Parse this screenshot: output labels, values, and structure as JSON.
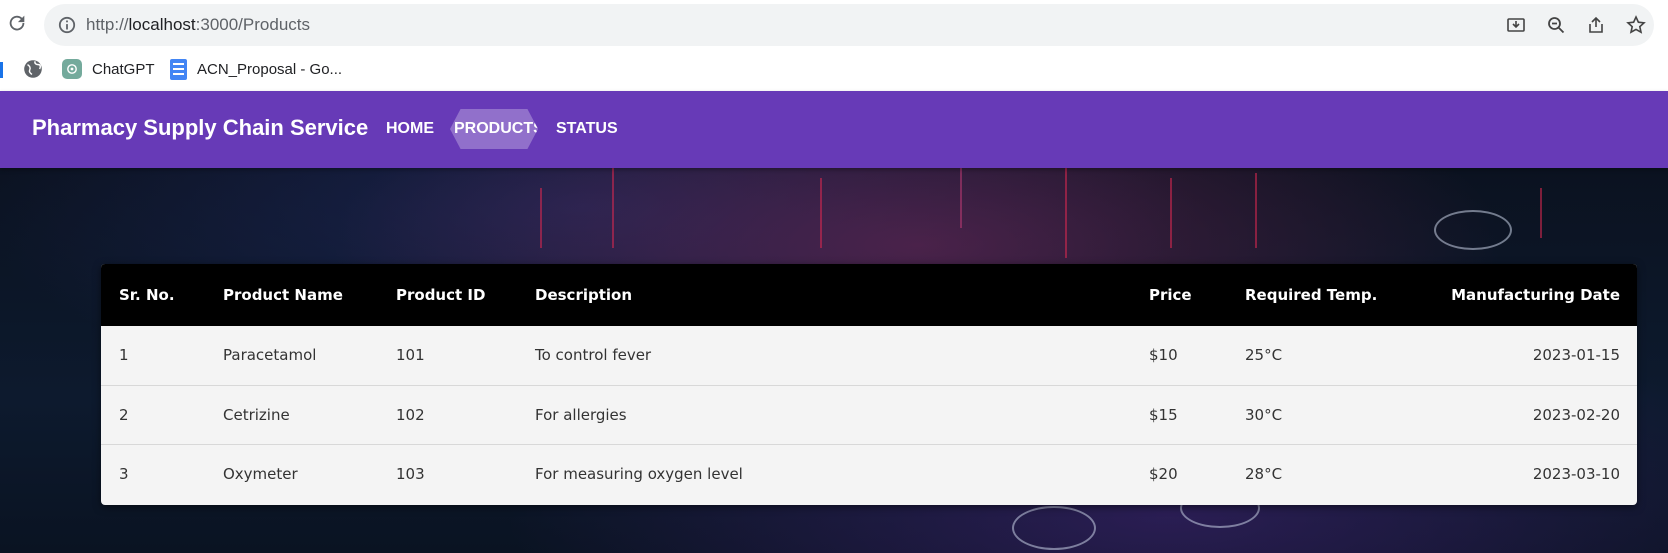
{
  "browser": {
    "url_prefix": "http://",
    "url_host": "localhost",
    "url_rest": ":3000/Products",
    "bookmarks": [
      {
        "label": "ChatGPT",
        "icon": "chatgpt-icon"
      },
      {
        "label": "ACN_Proposal - Go...",
        "icon": "google-docs-icon"
      }
    ]
  },
  "app": {
    "brand": "Pharmacy Supply Chain Service",
    "nav": [
      "HOME",
      "PRODUCTS",
      "STATUS"
    ],
    "active_nav": "PRODUCTS",
    "accent_color": "#673ab7"
  },
  "table": {
    "headers": [
      "Sr. No.",
      "Product Name",
      "Product ID",
      "Description",
      "Price",
      "Required Temp.",
      "Manufacturing Date"
    ],
    "rows": [
      [
        "1",
        "Paracetamol",
        "101",
        "To control fever",
        "$10",
        "25°C",
        "2023-01-15"
      ],
      [
        "2",
        "Cetrizine",
        "102",
        "For allergies",
        "$15",
        "30°C",
        "2023-02-20"
      ],
      [
        "3",
        "Oxymeter",
        "103",
        "For measuring oxygen level",
        "$20",
        "28°C",
        "2023-03-10"
      ]
    ]
  }
}
